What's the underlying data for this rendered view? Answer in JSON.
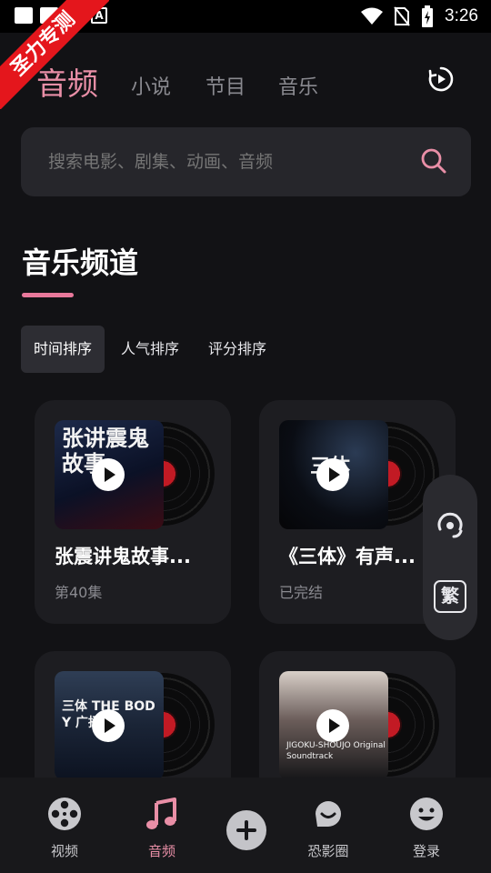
{
  "status_bar": {
    "time": "3:26"
  },
  "ribbon": {
    "text": "圣力专测"
  },
  "top_tabs": [
    {
      "label": "音频"
    },
    {
      "label": "小说"
    },
    {
      "label": "节目"
    },
    {
      "label": "音乐"
    }
  ],
  "search": {
    "placeholder": "搜索电影、剧集、动画、音频"
  },
  "section": {
    "title": "音乐频道"
  },
  "sort_options": [
    {
      "label": "时间排序"
    },
    {
      "label": "人气排序"
    },
    {
      "label": "评分排序"
    }
  ],
  "cards": [
    {
      "title": "张震讲鬼故事...",
      "subtitle": "第40集",
      "cover_text": "张讲震鬼故事"
    },
    {
      "title": "《三体》有声...",
      "subtitle": "已完结",
      "cover_text": "三体"
    },
    {
      "title": "",
      "subtitle": "",
      "cover_text": "三体 THE BODY 广播剧"
    },
    {
      "title": "",
      "subtitle": "",
      "cover_text": "JIGOKU-SHOUJO Original Soundtrack"
    }
  ],
  "float_panel": {
    "fan_label": "繁"
  },
  "bottom_nav": [
    {
      "label": "视频"
    },
    {
      "label": "音频"
    },
    {
      "label": "恐影圈"
    },
    {
      "label": "登录"
    }
  ],
  "colors": {
    "accent": "#e98fa7",
    "background": "#121215",
    "card": "#1d1d21"
  }
}
